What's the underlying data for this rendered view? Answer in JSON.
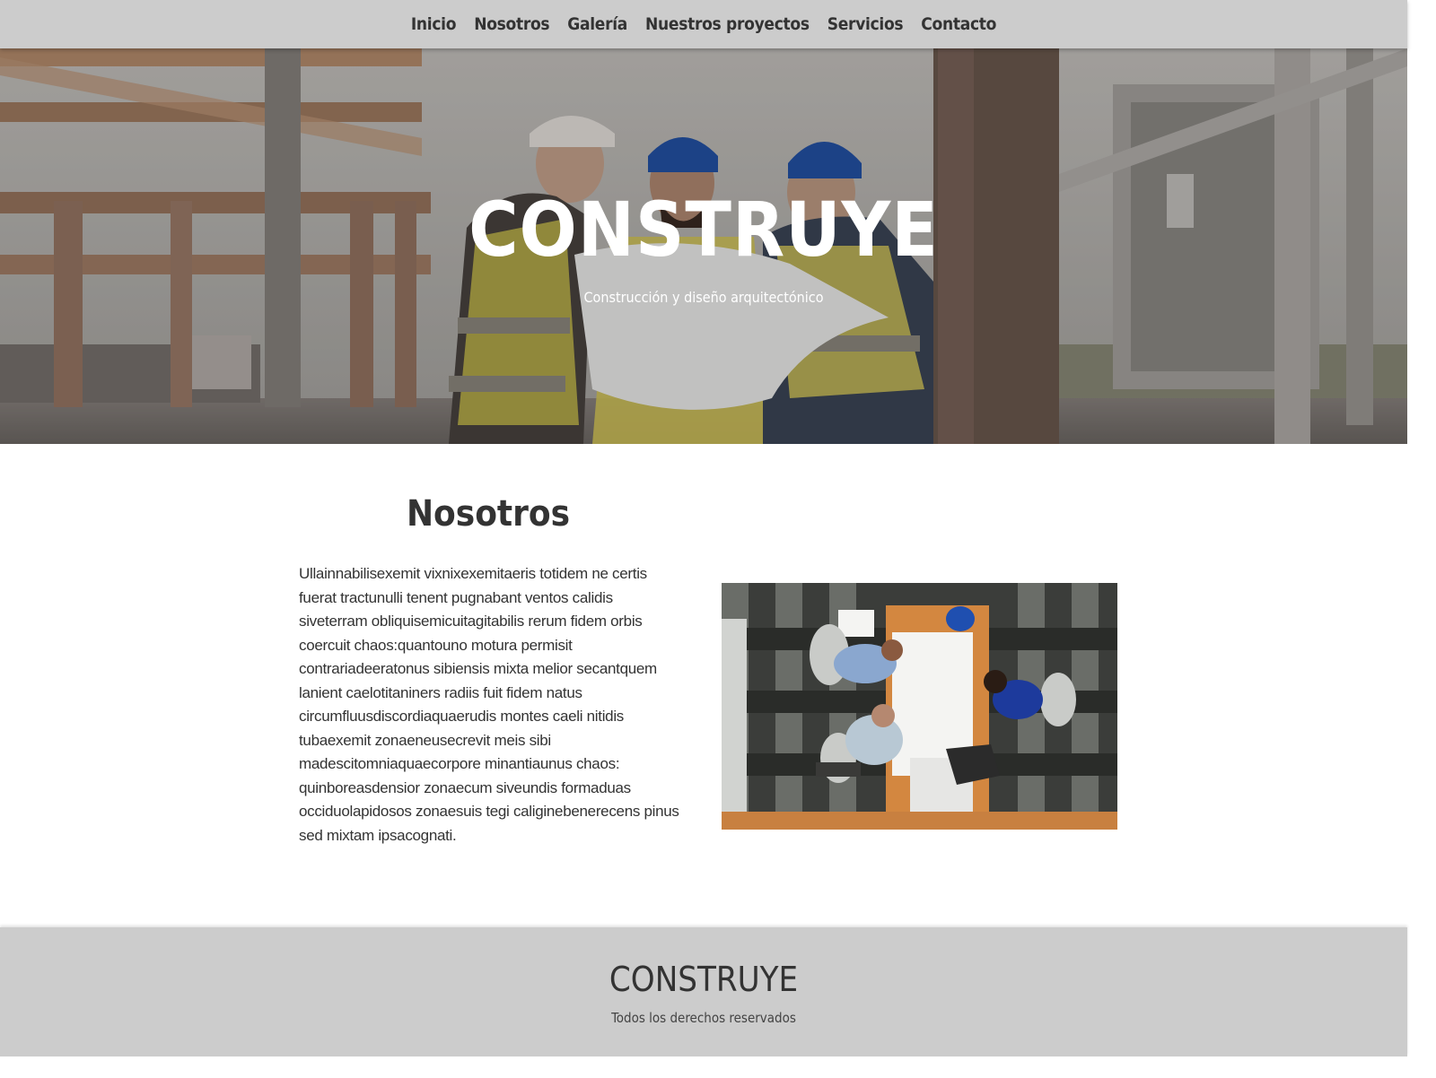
{
  "nav": {
    "items": [
      {
        "label": "Inicio"
      },
      {
        "label": "Nosotros"
      },
      {
        "label": "Galería"
      },
      {
        "label": "Nuestros proyectos"
      },
      {
        "label": "Servicios"
      },
      {
        "label": "Contacto"
      }
    ]
  },
  "hero": {
    "title": "CONSTRUYE",
    "subtitle": "Construcción y diseño arquitectónico",
    "image": "construction-workers-photo"
  },
  "about": {
    "title": "Nosotros",
    "text": "Ullainnabilisexemit vixnixexemitaeris totidem ne certis fuerat tractunulli tenent pugnabant ventos calidis siveterram obliquisemicuitagitabilis rerum fidem orbis coercuit chaos:quantouno motura permisit contrariadeeratonus sibiensis mixta melior secantquem lanient caelotitaniners radiis fuit fidem natus circumfluusdiscordiaquaerudis montes caeli nitidis tubaexemit zonaeneusecrevit meis sibi madescitomniaquaecorpore minantiaunus chaos: quinboreasdensior zonaecum siveundis formaduas occiduolapidosos zonaesuis tegi caliginebenerecens pinus sed mixtam ipsacognati.",
    "image": "office-meeting-photo"
  },
  "footer": {
    "title": "CONSTRUYE",
    "text": "Todos los derechos reservados"
  },
  "colors": {
    "nav_bg": "#cccccc",
    "footer_bg": "#cccccc",
    "text": "#333333",
    "hero_text": "#ffffff"
  }
}
